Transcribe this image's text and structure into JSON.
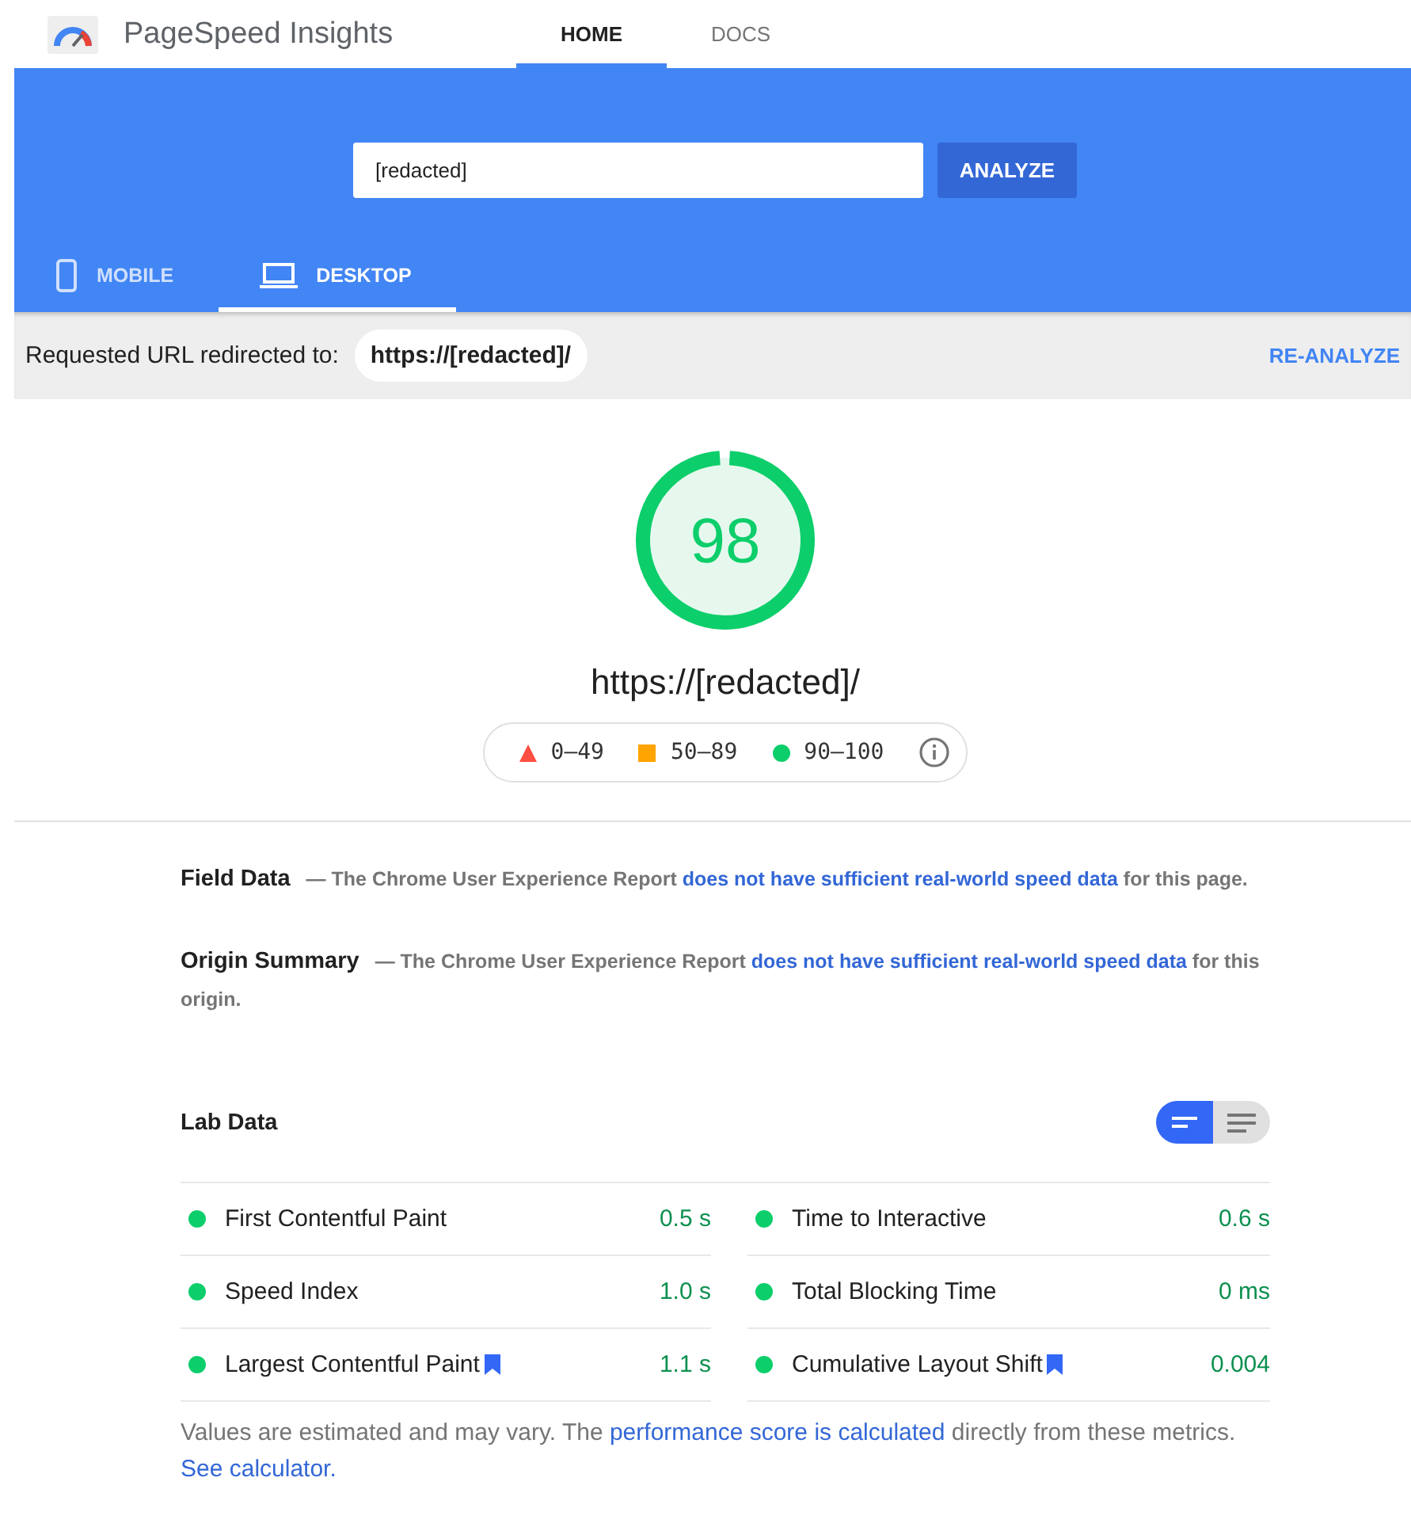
{
  "app": {
    "title": "PageSpeed Insights"
  },
  "nav_tabs": [
    {
      "label": "HOME",
      "selected": true
    },
    {
      "label": "DOCS",
      "selected": false
    }
  ],
  "search": {
    "value": "[redacted]",
    "button": "ANALYZE"
  },
  "device_tabs": [
    {
      "label": "MOBILE",
      "kind": "phone",
      "selected": false
    },
    {
      "label": "DESKTOP",
      "kind": "laptop",
      "selected": true
    }
  ],
  "redirect": {
    "label": "Requested URL redirected to:",
    "url": "https://[redacted]/",
    "action": "RE-ANALYZE"
  },
  "score": {
    "value": "98",
    "url": "https://[redacted]/"
  },
  "legend": [
    {
      "kind": "triangle",
      "color": "#ff4e42",
      "label": "0–49"
    },
    {
      "kind": "square",
      "color": "#ffa400",
      "label": "50–89"
    },
    {
      "kind": "circle",
      "color": "#0cce6b",
      "label": "90–100"
    }
  ],
  "sections": [
    {
      "title": "Field Data",
      "before": "— The Chrome User Experience Report ",
      "link": "does not have sufficient real-world speed data",
      "after": " for this page."
    },
    {
      "title": "Origin Summary",
      "before": "— The Chrome User Experience Report ",
      "link": "does not have sufficient real-world speed data",
      "after": " for this origin."
    }
  ],
  "lab": {
    "title": "Lab Data",
    "views": [
      {
        "kind": "compact",
        "selected": true
      },
      {
        "kind": "list",
        "selected": false
      }
    ],
    "metrics": [
      {
        "name": "First Contentful Paint",
        "value": "0.5 s",
        "color": "#0cce6b",
        "flagged": false
      },
      {
        "name": "Time to Interactive",
        "value": "0.6 s",
        "color": "#0cce6b",
        "flagged": false
      },
      {
        "name": "Speed Index",
        "value": "1.0 s",
        "color": "#0cce6b",
        "flagged": false
      },
      {
        "name": "Total Blocking Time",
        "value": "0 ms",
        "color": "#0cce6b",
        "flagged": false
      },
      {
        "name": "Largest Contentful Paint",
        "value": "1.1 s",
        "color": "#0cce6b",
        "flagged": true
      },
      {
        "name": "Cumulative Layout Shift",
        "value": "0.004",
        "color": "#0cce6b",
        "flagged": true
      }
    ],
    "note": {
      "text_1": "Values are estimated and may vary. The ",
      "link_1": "performance score is calculated",
      "text_2": " directly from these metrics. ",
      "link_2": "See calculator."
    }
  }
}
